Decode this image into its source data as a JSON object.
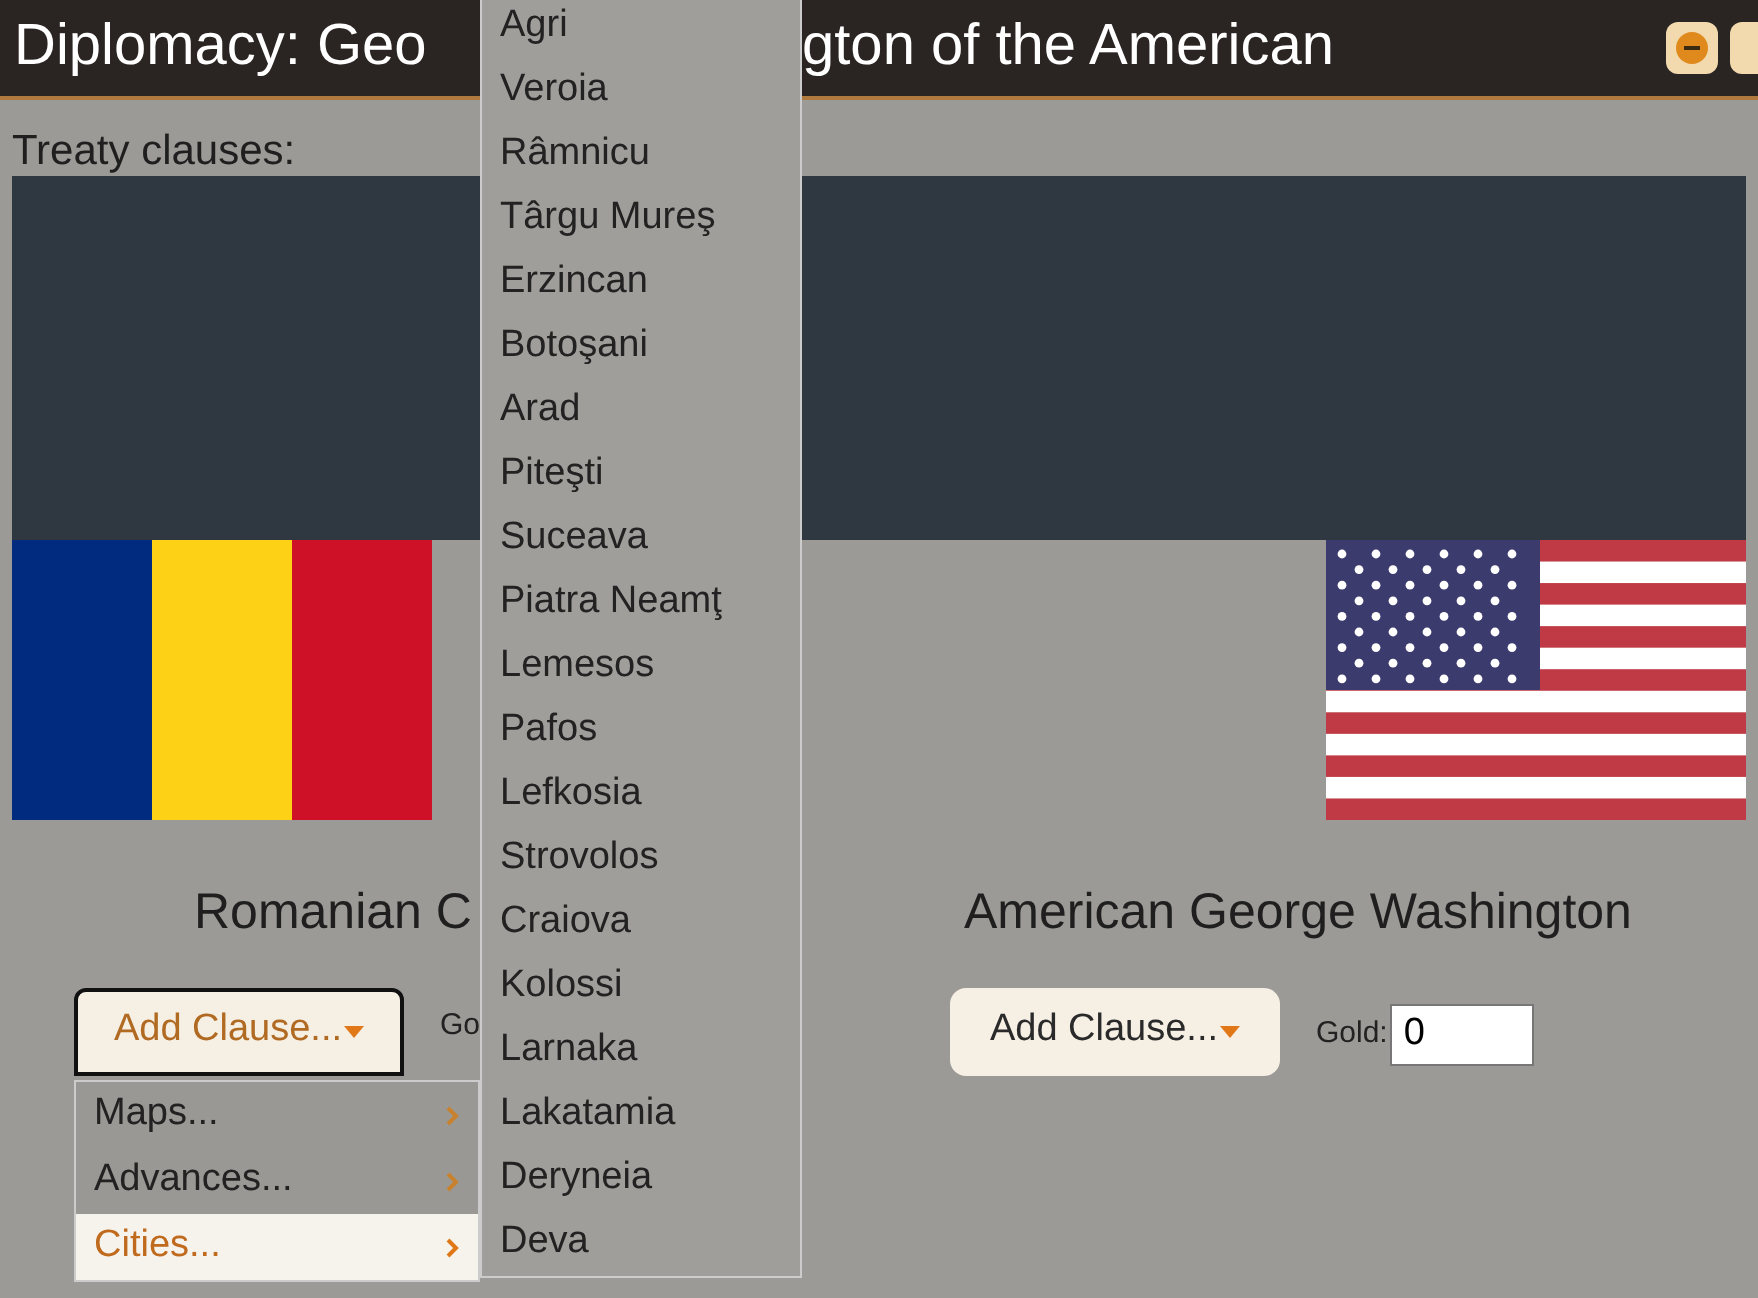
{
  "window": {
    "title_parts": [
      "Diplomacy: Geo",
      "gton of the American"
    ]
  },
  "window_buttons": [
    {
      "kind": "minimize"
    },
    {
      "kind": "close"
    }
  ],
  "treaty_label": "Treaty clauses:",
  "parties": [
    {
      "kind": "romania",
      "name": "Romanian C",
      "button": "Add Clause...",
      "gold_label": "Go",
      "menu_open": true
    },
    {
      "kind": "usa",
      "name": "American George Washington",
      "button": "Add Clause...",
      "gold_label": "Gold:",
      "gold_value": "0",
      "menu_open": false
    }
  ],
  "clause_menu": [
    {
      "label": "Maps...",
      "selected": false
    },
    {
      "label": "Advances...",
      "selected": false
    },
    {
      "label": "Cities...",
      "selected": true
    }
  ],
  "cities": [
    "Agri",
    "Veroia",
    "Râmnicu",
    "Târgu Mureş",
    "Erzincan",
    "Botoşani",
    "Arad",
    "Piteşti",
    "Suceava",
    "Piatra Neamţ",
    "Lemesos",
    "Pafos",
    "Lefkosia",
    "Strovolos",
    "Craiova",
    "Kolossi",
    "Larnaka",
    "Lakatamia",
    "Deryneia",
    "Deva"
  ]
}
